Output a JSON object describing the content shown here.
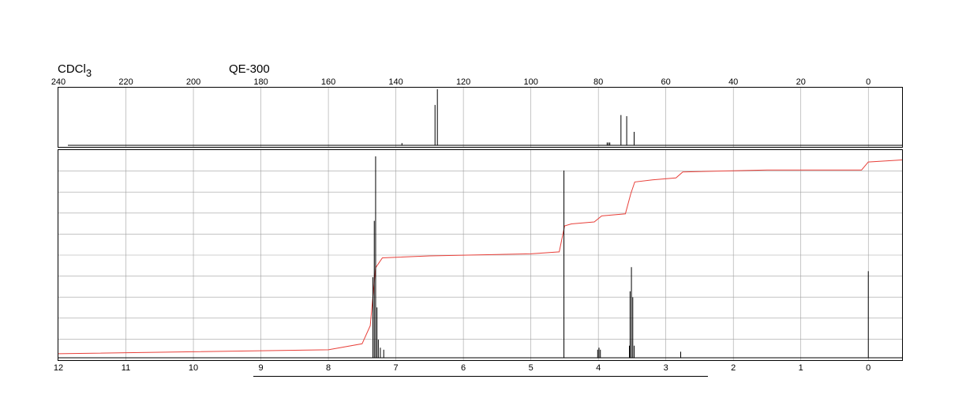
{
  "header": {
    "solvent": "CDCl",
    "solvent_subscript": "3",
    "instrument": "QE-300"
  },
  "chart_data": [
    {
      "type": "line",
      "nucleus": "13C",
      "xlim": [
        240,
        -10
      ],
      "x_ticks": [
        240,
        220,
        200,
        180,
        160,
        140,
        120,
        100,
        80,
        60,
        40,
        20,
        0
      ],
      "grid": "vertical",
      "peaks": [
        {
          "x": 138.2,
          "y": 0.04
        },
        {
          "x": 128.4,
          "y": 0.72
        },
        {
          "x": 127.7,
          "y": 1.0
        },
        {
          "x": 77.4,
          "y": 0.05
        },
        {
          "x": 77.0,
          "y": 0.05
        },
        {
          "x": 76.6,
          "y": 0.05
        },
        {
          "x": 73.3,
          "y": 0.54
        },
        {
          "x": 71.6,
          "y": 0.52
        },
        {
          "x": 69.4,
          "y": 0.24
        }
      ]
    },
    {
      "type": "line",
      "nucleus": "1H",
      "xlim": [
        12,
        -0.5
      ],
      "x_ticks": [
        12,
        11,
        10,
        9,
        8,
        7,
        6,
        5,
        4,
        3,
        2,
        1,
        0
      ],
      "grid": "both",
      "peaks": [
        {
          "x": 7.34,
          "y": 0.4
        },
        {
          "x": 7.32,
          "y": 0.68
        },
        {
          "x": 7.3,
          "y": 1.0
        },
        {
          "x": 7.28,
          "y": 0.25
        },
        {
          "x": 7.26,
          "y": 0.09
        },
        {
          "x": 7.23,
          "y": 0.05
        },
        {
          "x": 7.18,
          "y": 0.04
        },
        {
          "x": 4.51,
          "y": 0.93
        },
        {
          "x": 4.01,
          "y": 0.04
        },
        {
          "x": 3.99,
          "y": 0.05
        },
        {
          "x": 3.97,
          "y": 0.04
        },
        {
          "x": 3.54,
          "y": 0.06
        },
        {
          "x": 3.53,
          "y": 0.33
        },
        {
          "x": 3.51,
          "y": 0.45
        },
        {
          "x": 3.49,
          "y": 0.3
        },
        {
          "x": 3.47,
          "y": 0.06
        },
        {
          "x": 2.78,
          "y": 0.03
        },
        {
          "x": 0.0,
          "y": 0.43
        }
      ],
      "integral": [
        [
          12,
          0.02
        ],
        [
          10,
          0.03
        ],
        [
          8,
          0.04
        ],
        [
          7.5,
          0.07
        ],
        [
          7.38,
          0.16
        ],
        [
          7.3,
          0.45
        ],
        [
          7.2,
          0.5
        ],
        [
          6.5,
          0.51
        ],
        [
          5.0,
          0.52
        ],
        [
          4.58,
          0.53
        ],
        [
          4.5,
          0.66
        ],
        [
          4.4,
          0.67
        ],
        [
          4.06,
          0.68
        ],
        [
          3.95,
          0.71
        ],
        [
          3.6,
          0.72
        ],
        [
          3.52,
          0.82
        ],
        [
          3.46,
          0.88
        ],
        [
          3.2,
          0.89
        ],
        [
          2.85,
          0.9
        ],
        [
          2.75,
          0.93
        ],
        [
          1.5,
          0.94
        ],
        [
          0.1,
          0.94
        ],
        [
          0.0,
          0.98
        ],
        [
          -0.5,
          0.99
        ]
      ],
      "colors": {
        "trace": "#000000",
        "integral": "#e8403a",
        "grid": "#a0a0a0"
      }
    }
  ]
}
